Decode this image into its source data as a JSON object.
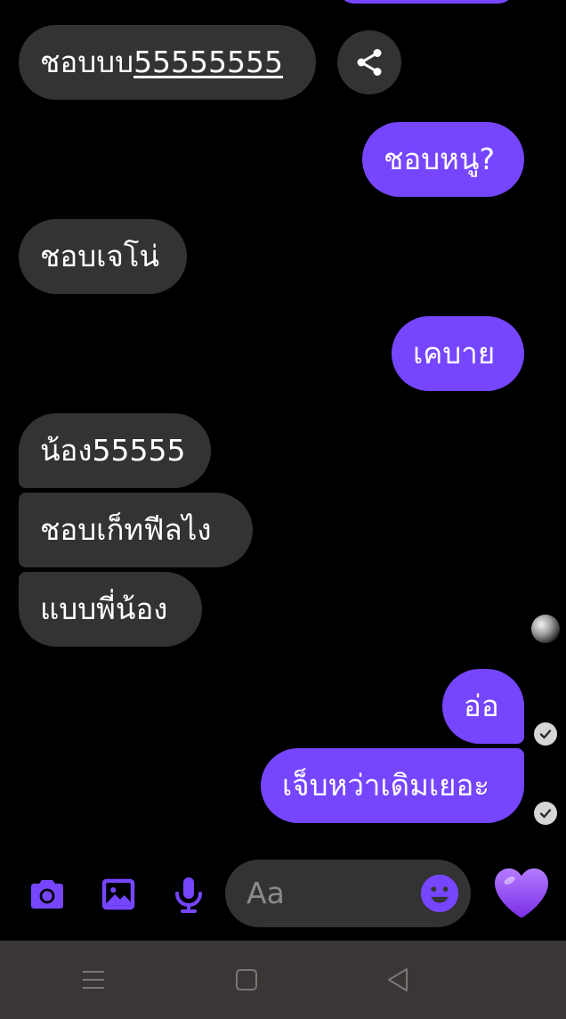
{
  "messages": [
    {
      "text": "ชอบบบ",
      "link": "55555555"
    },
    {
      "text": "ชอบหนู?"
    },
    {
      "text": "ชอบเจโน่"
    },
    {
      "text": "เคบาย"
    },
    {
      "text": "น้อง55555"
    },
    {
      "text": "ชอบเก็ทฟีลไง"
    },
    {
      "text": "แบบพี่น้อง"
    },
    {
      "text": "อ่อ"
    },
    {
      "text": "เจ็บหว่าเดิมเยอะ"
    }
  ],
  "composer": {
    "placeholder": "Aa",
    "icons": [
      "camera-icon",
      "image-icon",
      "microphone-icon",
      "emoji-icon",
      "heart-icon"
    ]
  },
  "colors": {
    "outgoing": "#7646ff",
    "incoming": "#333333",
    "background": "#000000",
    "navbar": "#3b3636"
  },
  "navbar": {
    "icons": [
      "menu-icon",
      "home-icon",
      "back-icon"
    ]
  }
}
